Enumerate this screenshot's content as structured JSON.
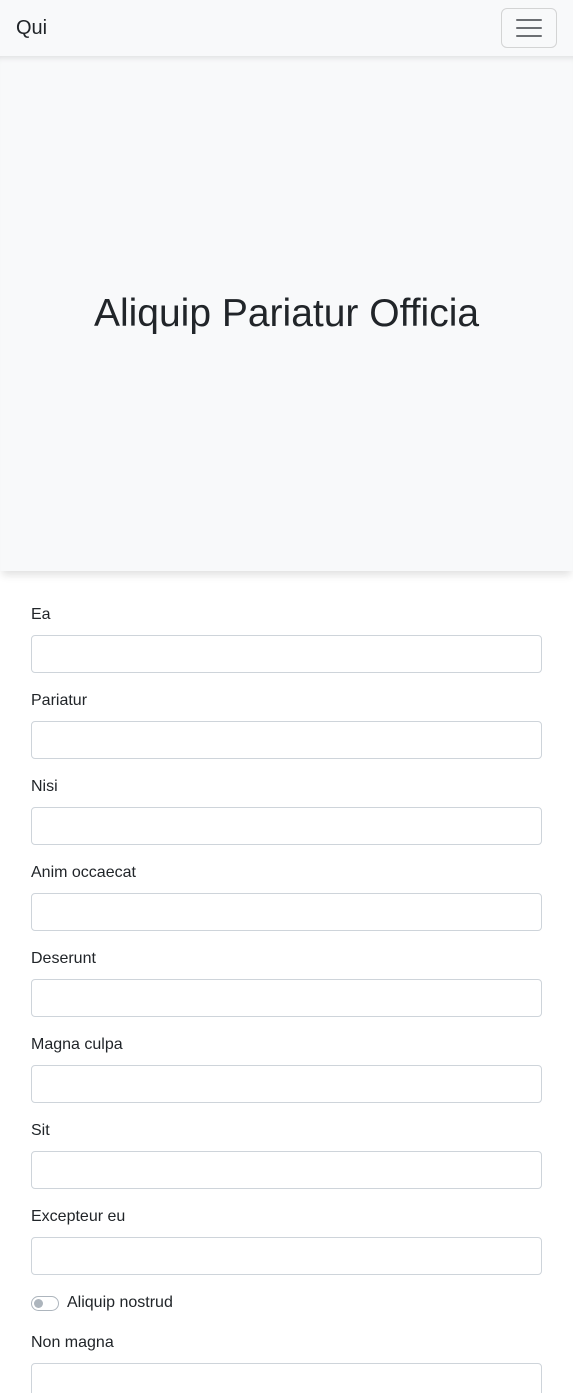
{
  "navbar": {
    "brand": "Qui",
    "toggler_icon": "hamburger-menu-icon"
  },
  "hero": {
    "title": "Aliquip Pariatur Officia"
  },
  "form": {
    "fields": [
      {
        "label": "Ea",
        "value": ""
      },
      {
        "label": "Pariatur",
        "value": ""
      },
      {
        "label": "Nisi",
        "value": ""
      },
      {
        "label": "Anim occaecat",
        "value": ""
      },
      {
        "label": "Deserunt",
        "value": ""
      },
      {
        "label": "Magna culpa",
        "value": ""
      },
      {
        "label": "Sit",
        "value": ""
      },
      {
        "label": "Excepteur eu",
        "value": ""
      }
    ],
    "toggle": {
      "label": "Aliquip nostrud",
      "checked": false
    },
    "last_field": {
      "label": "Non magna",
      "value": ""
    }
  },
  "colors": {
    "navbar_bg": "#f8f9fa",
    "text": "#212529",
    "input_border": "#ced4da"
  }
}
